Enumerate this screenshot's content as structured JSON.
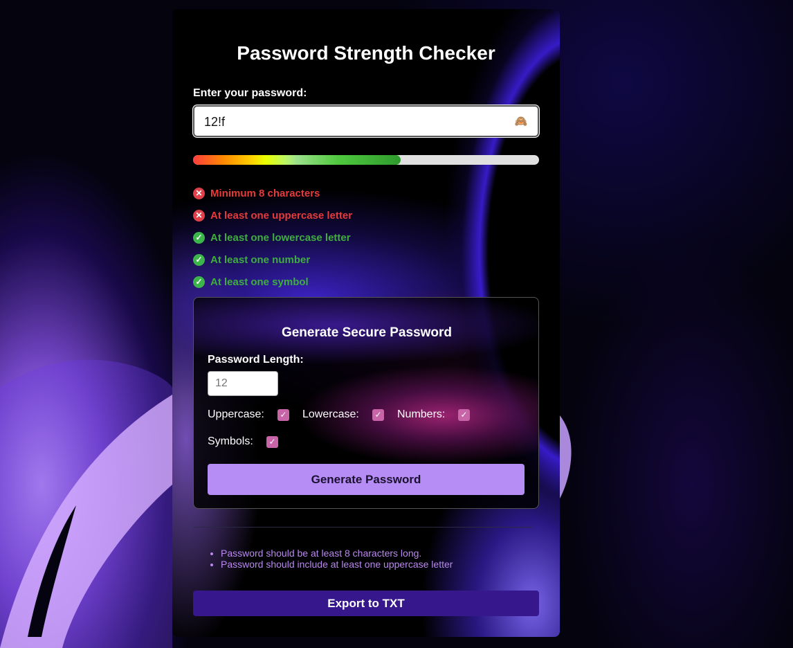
{
  "title": "Password Strength Checker",
  "password": {
    "label": "Enter your password:",
    "value": "12!f",
    "toggle_icon": "see-no-evil-monkey-icon"
  },
  "strength": {
    "level": 0.6
  },
  "requirements": [
    {
      "text": "Minimum 8 characters",
      "met": false
    },
    {
      "text": "At least one uppercase letter",
      "met": false
    },
    {
      "text": "At least one lowercase letter",
      "met": true
    },
    {
      "text": "At least one number",
      "met": true
    },
    {
      "text": "At least one symbol",
      "met": true
    }
  ],
  "generator": {
    "title": "Generate Secure Password",
    "length_label": "Password Length:",
    "length_placeholder": "12",
    "options": [
      {
        "label": "Uppercase:",
        "checked": true
      },
      {
        "label": "Lowercase:",
        "checked": true
      },
      {
        "label": "Numbers:",
        "checked": true
      },
      {
        "label": "Symbols:",
        "checked": true
      }
    ],
    "button_label": "Generate Password"
  },
  "tips": [
    "Password should be at least 8 characters long.",
    "Password should include at least one uppercase letter"
  ],
  "export_label": "Export to TXT",
  "colors": {
    "fail": "#e53b3b",
    "pass": "#3fae3f",
    "checkbox": "#c864a8",
    "generate_button": "#b68cf5",
    "export_button": "#37178c"
  }
}
